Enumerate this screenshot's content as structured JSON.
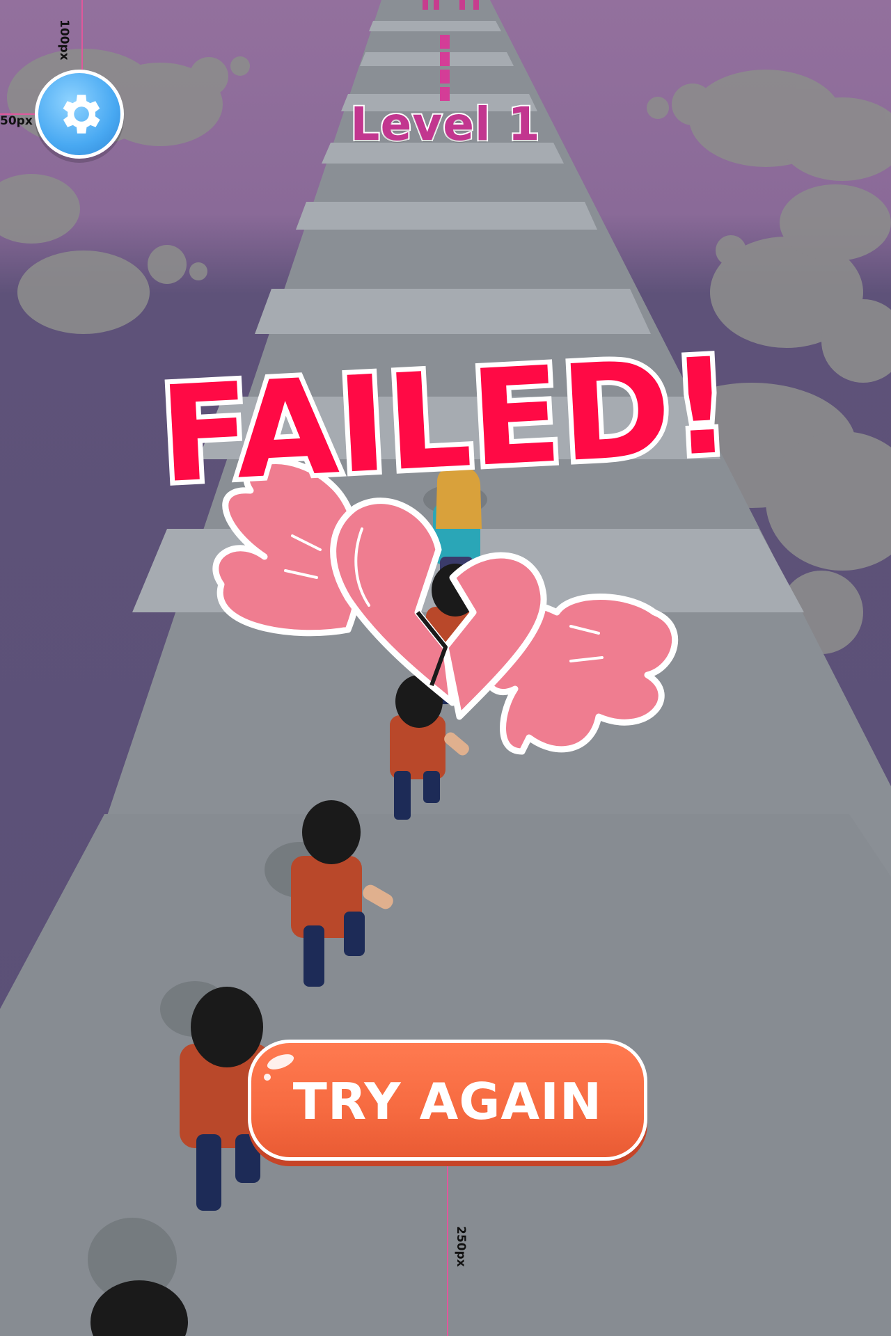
{
  "hud": {
    "level_label": "Level 1",
    "settings_icon": "gear-icon"
  },
  "result": {
    "title": "FAILED!",
    "emblem_icon": "broken-winged-heart-icon"
  },
  "actions": {
    "try_again_label": "TRY AGAIN"
  },
  "dev_guides": {
    "top_margin": "100px",
    "left_margin": "50px",
    "bottom_margin": "250px"
  },
  "colors": {
    "sky": "#5c5178",
    "sky_top": "#8c6a9a",
    "road": "#8a8f95",
    "road_stripe": "#a6abb1",
    "failed_text": "#ff0a45",
    "level_text": "#c2368f",
    "button": "#f66a40",
    "settings_button": "#49a9f2",
    "heart": "#ef7d90",
    "guide_line": "#e0589c"
  }
}
